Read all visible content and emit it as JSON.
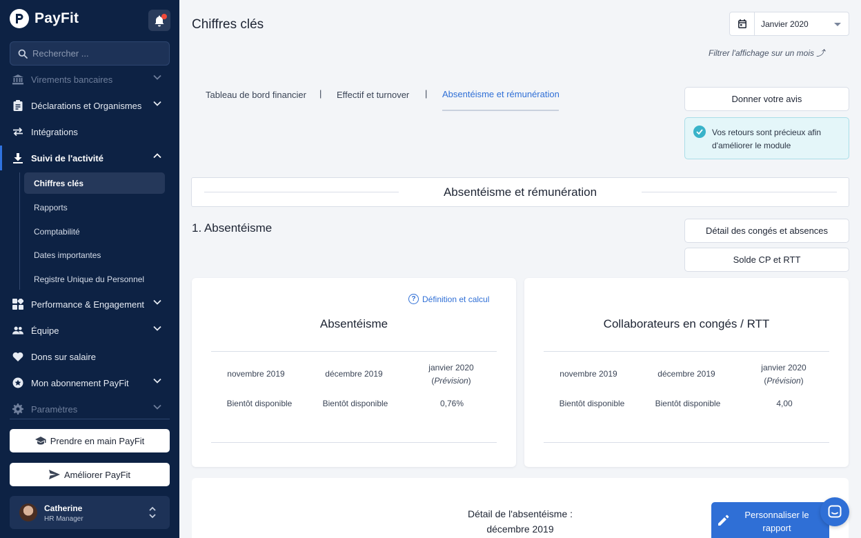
{
  "app": {
    "name": "PayFit"
  },
  "sidebar": {
    "search_placeholder": "Rechercher ...",
    "items": [
      {
        "label": "Virements bancaires",
        "icon": "bank-icon"
      },
      {
        "label": "Déclarations et Organismes",
        "icon": "clipboard-icon"
      },
      {
        "label": "Intégrations",
        "icon": "swap-arrows-icon"
      },
      {
        "label": "Suivi de l'activité",
        "icon": "download-icon"
      },
      {
        "label": "Performance & Engagement",
        "icon": "widgets-icon"
      },
      {
        "label": "Équipe",
        "icon": "people-icon"
      },
      {
        "label": "Dons sur salaire",
        "icon": "heart-icon"
      },
      {
        "label": "Mon abonnement PayFit",
        "icon": "star-badge-icon"
      },
      {
        "label": "Paramètres",
        "icon": "gear-icon"
      }
    ],
    "sub_items": [
      "Chiffres clés",
      "Rapports",
      "Comptabilité",
      "Dates importantes",
      "Registre Unique du Personnel"
    ],
    "onboarding_button": "Prendre en main PayFit",
    "improve_button": "Améliorer PayFit",
    "user": {
      "name": "Catherine",
      "role": "HR Manager"
    }
  },
  "header": {
    "title": "Chiffres clés",
    "date_value": "Janvier 2020",
    "filter_hint": "Filtrer l'affichage sur un mois ⤴"
  },
  "tabs": [
    {
      "label": "Tableau de bord financier"
    },
    {
      "label": "Effectif et turnover"
    },
    {
      "label": "Absentéisme et rémunération"
    }
  ],
  "tab_separator": "|",
  "feedback": {
    "button": "Donner votre avis",
    "note": "Vos retours sont précieux afin d'améliorer le module"
  },
  "section": {
    "banner_title": "Absentéisme et rémunération",
    "heading": "1. Absentéisme",
    "detail_button": "Détail des congés et absences",
    "balance_button": "Solde CP et RTT"
  },
  "cards": [
    {
      "title": "Absentéisme",
      "link": "Définition et calcul",
      "columns": [
        "novembre 2019",
        "décembre 2019",
        "janvier 2020"
      ],
      "forecast_label": "Prévision",
      "values": [
        "Bientôt disponible",
        "Bientôt disponible",
        "0,76%"
      ]
    },
    {
      "title": "Collaborateurs en congés / RTT",
      "columns": [
        "novembre 2019",
        "décembre 2019",
        "janvier 2020"
      ],
      "forecast_label": "Prévision",
      "values": [
        "Bientôt disponible",
        "Bientôt disponible",
        "4,00"
      ]
    }
  ],
  "detail": {
    "line1": "Détail de l'absentéisme :",
    "line2": "décembre 2019"
  },
  "customize_button": "Personnaliser le rapport",
  "colors": {
    "sidebar_bg": "#0d2244",
    "accent": "#2f6fd6",
    "notification": "#f04a3a",
    "success": "#39b3c9"
  }
}
